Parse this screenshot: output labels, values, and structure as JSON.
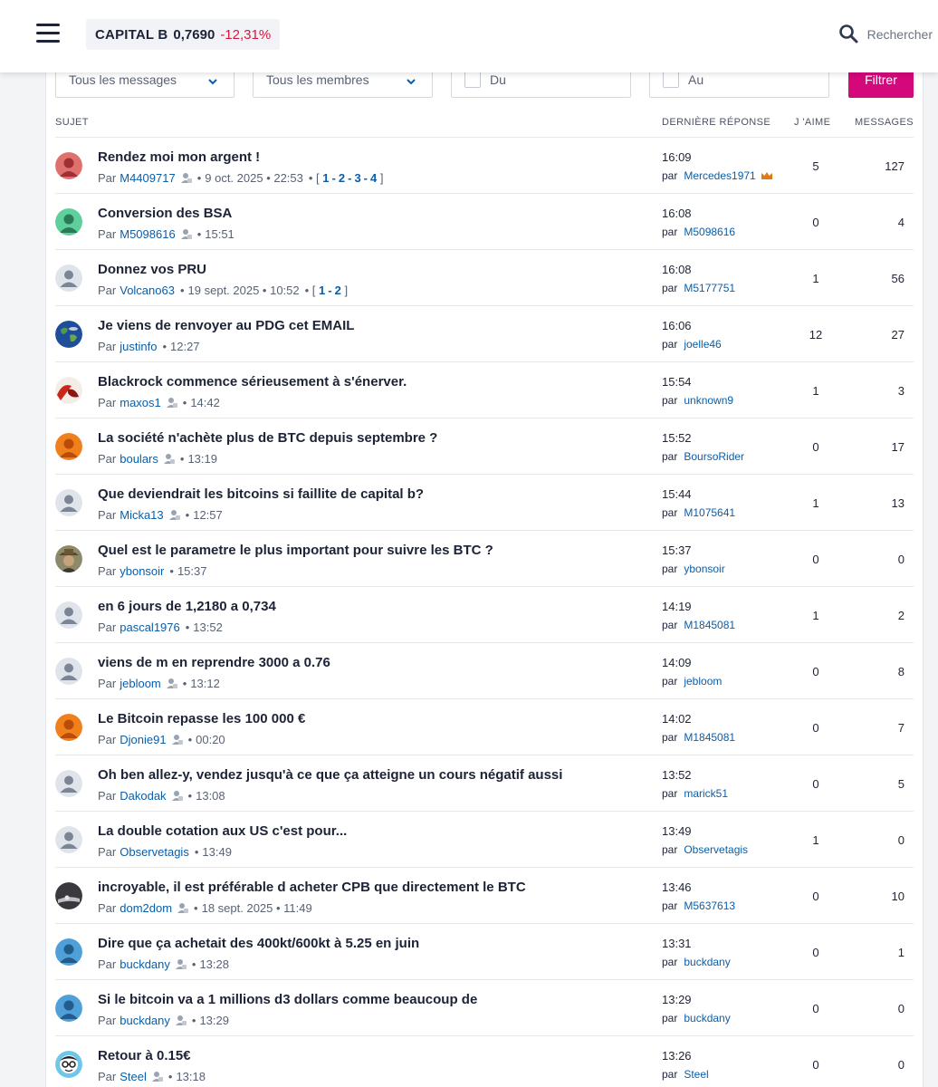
{
  "header": {
    "ticker_name": "CAPITAL B",
    "ticker_price": "0,7690",
    "ticker_change": "-12,31%",
    "search_label": "Rechercher"
  },
  "filters": {
    "messages_select": "Tous les messages",
    "members_select": "Tous les membres",
    "date_from": "Du",
    "date_to": "Au",
    "filter_button": "Filtrer"
  },
  "table": {
    "col_subject": "SUJET",
    "col_last_reply": "DERNIÈRE RÉPONSE",
    "col_likes": "J 'AIME",
    "col_messages": "MESSAGES",
    "by_label": "Par",
    "last_by_label": "par"
  },
  "colors": {
    "accent": "#d4087a",
    "link": "#0a5ea8",
    "negative": "#d6183c"
  },
  "topics": [
    {
      "title": "Rendez moi mon argent !",
      "author": "M4409717",
      "badge": true,
      "date": "9 oct. 2025 • 22:53",
      "pages": [
        "1",
        "2",
        "3",
        "4"
      ],
      "last_time": "16:09",
      "last_author": "Mercedes1971",
      "crown": true,
      "likes": "5",
      "messages": "127",
      "avatar": "red-person"
    },
    {
      "title": "Conversion des BSA",
      "author": "M5098616",
      "badge": true,
      "date": "15:51",
      "pages": [],
      "last_time": "16:08",
      "last_author": "M5098616",
      "crown": false,
      "likes": "0",
      "messages": "4",
      "avatar": "green-person"
    },
    {
      "title": "Donnez vos PRU",
      "author": "Volcano63",
      "badge": false,
      "date": "19 sept. 2025 • 10:52",
      "pages": [
        "1",
        "2"
      ],
      "last_time": "16:08",
      "last_author": "M5177751",
      "crown": false,
      "likes": "1",
      "messages": "56",
      "avatar": "default"
    },
    {
      "title": "Je viens de renvoyer au PDG cet EMAIL",
      "author": "justinfo",
      "badge": false,
      "date": "12:27",
      "pages": [],
      "last_time": "16:06",
      "last_author": "joelle46",
      "crown": false,
      "likes": "12",
      "messages": "27",
      "avatar": "earth"
    },
    {
      "title": "Blackrock commence sérieusement à s'énerver.",
      "author": "maxos1",
      "badge": true,
      "date": "14:42",
      "pages": [],
      "last_time": "15:54",
      "last_author": "unknown9",
      "crown": false,
      "likes": "1",
      "messages": "3",
      "avatar": "red-flower"
    },
    {
      "title": "La société n'achète plus de BTC depuis septembre ?",
      "author": "boulars",
      "badge": true,
      "date": "13:19",
      "pages": [],
      "last_time": "15:52",
      "last_author": "BoursoRider",
      "crown": false,
      "likes": "0",
      "messages": "17",
      "avatar": "orange-person"
    },
    {
      "title": "Que deviendrait les bitcoins si faillite de capital b?",
      "author": "Micka13",
      "badge": true,
      "date": "12:57",
      "pages": [],
      "last_time": "15:44",
      "last_author": "M1075641",
      "crown": false,
      "likes": "1",
      "messages": "13",
      "avatar": "default"
    },
    {
      "title": "Quel est le parametre le plus important pour suivre les BTC ?",
      "author": "ybonsoir",
      "badge": false,
      "date": "15:37",
      "pages": [],
      "last_time": "15:37",
      "last_author": "ybonsoir",
      "crown": false,
      "likes": "0",
      "messages": "0",
      "avatar": "cowboy"
    },
    {
      "title": "en 6 jours de 1,2180 a 0,734",
      "author": "pascal1976",
      "badge": false,
      "date": "13:52",
      "pages": [],
      "last_time": "14:19",
      "last_author": "M1845081",
      "crown": false,
      "likes": "1",
      "messages": "2",
      "avatar": "default"
    },
    {
      "title": "viens de m en reprendre 3000 a 0.76",
      "author": "jebloom",
      "badge": true,
      "date": "13:12",
      "pages": [],
      "last_time": "14:09",
      "last_author": "jebloom",
      "crown": false,
      "likes": "0",
      "messages": "8",
      "avatar": "default"
    },
    {
      "title": "Le Bitcoin repasse les 100 000 €",
      "author": "Djonie91",
      "badge": true,
      "date": "00:20",
      "pages": [],
      "last_time": "14:02",
      "last_author": "M1845081",
      "crown": false,
      "likes": "0",
      "messages": "7",
      "avatar": "orange-person"
    },
    {
      "title": "Oh ben allez-y, vendez jusqu'à ce que ça atteigne un cours négatif aussi",
      "author": "Dakodak",
      "badge": true,
      "date": "13:08",
      "pages": [],
      "last_time": "13:52",
      "last_author": "marick51",
      "crown": false,
      "likes": "0",
      "messages": "5",
      "avatar": "default"
    },
    {
      "title": "La double cotation aux US c'est pour...",
      "author": "Observetagis",
      "badge": false,
      "date": "13:49",
      "pages": [],
      "last_time": "13:49",
      "last_author": "Observetagis",
      "crown": false,
      "likes": "1",
      "messages": "0",
      "avatar": "default"
    },
    {
      "title": "incroyable, il est préférable d acheter CPB que directement le BTC",
      "author": "dom2dom",
      "badge": true,
      "date": "18 sept. 2025 • 11:49",
      "pages": [],
      "last_time": "13:46",
      "last_author": "M5637613",
      "crown": false,
      "likes": "0",
      "messages": "10",
      "avatar": "dark-photo"
    },
    {
      "title": "Dire que ça achetait des 400kt/600kt à 5.25 en juin",
      "author": "buckdany",
      "badge": true,
      "date": "13:28",
      "pages": [],
      "last_time": "13:31",
      "last_author": "buckdany",
      "crown": false,
      "likes": "0",
      "messages": "1",
      "avatar": "blue-person"
    },
    {
      "title": "Si le bitcoin va a 1 millions d3 dollars comme beaucoup de",
      "author": "buckdany",
      "badge": true,
      "date": "13:29",
      "pages": [],
      "last_time": "13:29",
      "last_author": "buckdany",
      "crown": false,
      "likes": "0",
      "messages": "0",
      "avatar": "blue-person"
    },
    {
      "title": "Retour à 0.15€",
      "author": "Steel",
      "badge": true,
      "date": "13:18",
      "pages": [],
      "last_time": "13:26",
      "last_author": "Steel",
      "crown": false,
      "likes": "0",
      "messages": "0",
      "avatar": "glasses-cartoon"
    }
  ]
}
